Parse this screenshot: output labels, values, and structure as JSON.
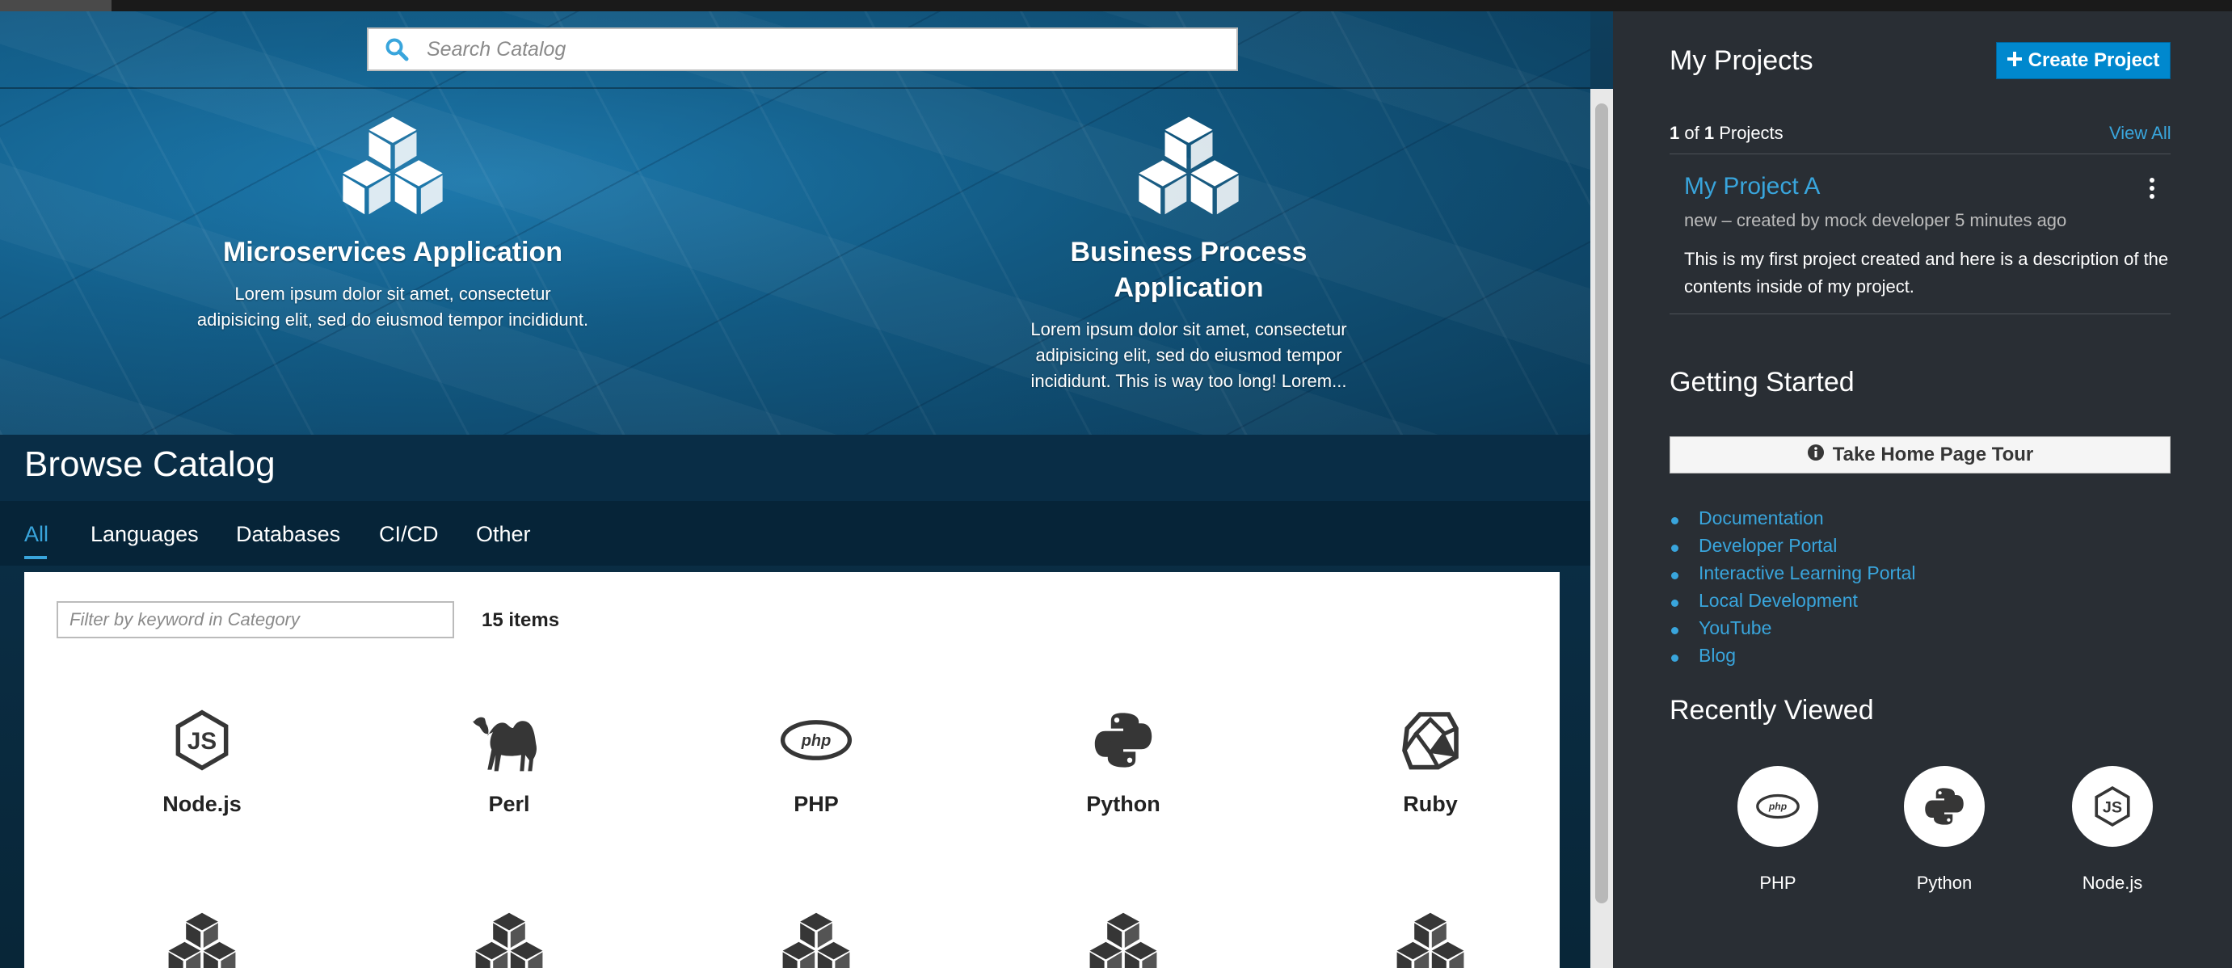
{
  "search": {
    "placeholder": "Search Catalog"
  },
  "hero": {
    "features": [
      {
        "title": "Microservices Application",
        "description": "Lorem ipsum dolor sit amet, consectetur adipisicing elit, sed do eiusmod tempor incididunt."
      },
      {
        "title": "Business Process Application",
        "description": "Lorem ipsum dolor sit amet, consectetur adipisicing elit, sed do eiusmod tempor incididunt. This is way too long! Lorem..."
      }
    ]
  },
  "catalog": {
    "title": "Browse Catalog",
    "tabs": [
      {
        "label": "All",
        "active": true
      },
      {
        "label": "Languages"
      },
      {
        "label": "Databases"
      },
      {
        "label": "CI/CD"
      },
      {
        "label": "Other"
      }
    ],
    "filter_placeholder": "Filter by keyword in Category",
    "item_count": "15 items",
    "items": [
      {
        "label": "Node.js",
        "icon": "nodejs-icon"
      },
      {
        "label": "Perl",
        "icon": "perl-camel-icon"
      },
      {
        "label": "PHP",
        "icon": "php-icon"
      },
      {
        "label": "Python",
        "icon": "python-icon"
      },
      {
        "label": "Ruby",
        "icon": "ruby-icon"
      }
    ]
  },
  "projects": {
    "title": "My Projects",
    "create_label": "Create Project",
    "count_current": "1",
    "count_of": " of ",
    "count_total": "1",
    "count_suffix": " Projects",
    "view_all": "View All",
    "items": [
      {
        "name": "My Project A",
        "meta": "new – created by mock developer 5 minutes ago",
        "description": "This is my first project created and here is a description of the contents inside of my project."
      }
    ]
  },
  "getting_started": {
    "title": "Getting Started",
    "tour_label": "Take Home Page Tour",
    "links": [
      "Documentation",
      "Developer Portal",
      "Interactive Learning Portal",
      "Local Development",
      "YouTube",
      "Blog"
    ]
  },
  "recently_viewed": {
    "title": "Recently Viewed",
    "items": [
      {
        "label": "PHP",
        "icon": "php-icon"
      },
      {
        "label": "Python",
        "icon": "python-icon"
      },
      {
        "label": "Node.js",
        "icon": "nodejs-icon"
      }
    ]
  },
  "colors": {
    "accent": "#39a5dc",
    "primary_button": "#0088ce",
    "sidebar_bg": "#292e34"
  }
}
